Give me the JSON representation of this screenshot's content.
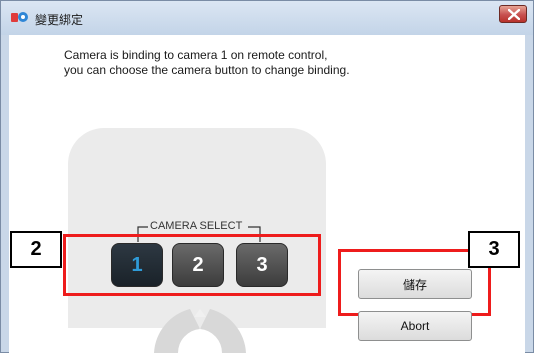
{
  "window": {
    "title": "變更綁定"
  },
  "message": {
    "line1": "Camera is binding to camera 1 on remote control,",
    "line2": "you can choose the camera button to change binding."
  },
  "remote": {
    "camera_select_label": "CAMERA SELECT",
    "buttons": [
      {
        "label": "1",
        "active": true
      },
      {
        "label": "2",
        "active": false
      },
      {
        "label": "3",
        "active": false
      }
    ]
  },
  "annotations": {
    "marker_2": "2",
    "marker_3": "3"
  },
  "actions": {
    "save_label": "儲存",
    "abort_label": "Abort"
  },
  "colors": {
    "highlight_red": "#ee1c1c",
    "active_digit": "#2f9bd8"
  }
}
